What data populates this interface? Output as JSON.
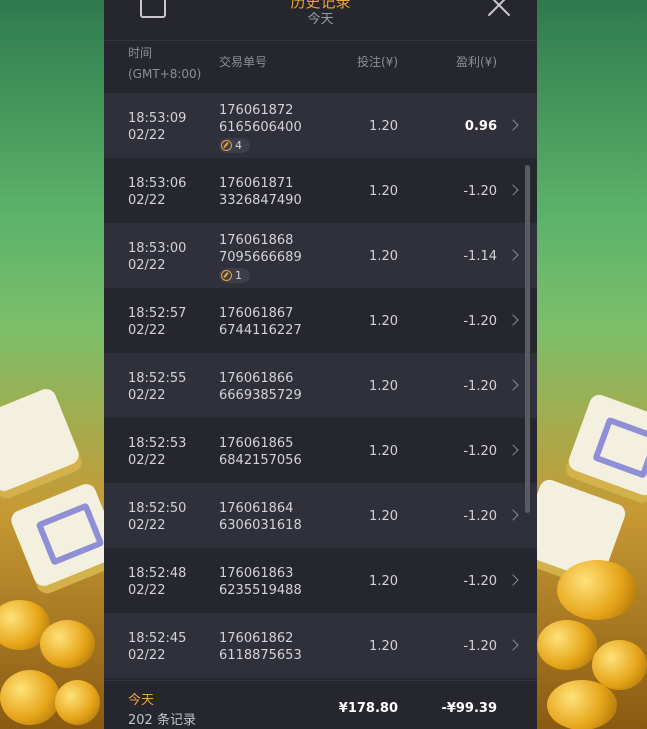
{
  "topbar": {
    "title": "历史记录",
    "subtitle": "今天"
  },
  "columns": {
    "time": "时间",
    "timezone": "(GMT+8:00)",
    "id": "交易单号",
    "bet": "投注(¥)",
    "profit": "盈利(¥)"
  },
  "rows": [
    {
      "time": "18:53:09",
      "date": "02/22",
      "id1": "176061872",
      "id2": "6165606400",
      "bet": "1.20",
      "profit": "0.96",
      "badge": "4"
    },
    {
      "time": "18:53:06",
      "date": "02/22",
      "id1": "176061871",
      "id2": "3326847490",
      "bet": "1.20",
      "profit": "-1.20"
    },
    {
      "time": "18:53:00",
      "date": "02/22",
      "id1": "176061868",
      "id2": "7095666689",
      "bet": "1.20",
      "profit": "-1.14",
      "badge": "1"
    },
    {
      "time": "18:52:57",
      "date": "02/22",
      "id1": "176061867",
      "id2": "6744116227",
      "bet": "1.20",
      "profit": "-1.20"
    },
    {
      "time": "18:52:55",
      "date": "02/22",
      "id1": "176061866",
      "id2": "6669385729",
      "bet": "1.20",
      "profit": "-1.20"
    },
    {
      "time": "18:52:53",
      "date": "02/22",
      "id1": "176061865",
      "id2": "6842157056",
      "bet": "1.20",
      "profit": "-1.20"
    },
    {
      "time": "18:52:50",
      "date": "02/22",
      "id1": "176061864",
      "id2": "6306031618",
      "bet": "1.20",
      "profit": "-1.20"
    },
    {
      "time": "18:52:48",
      "date": "02/22",
      "id1": "176061863",
      "id2": "6235519488",
      "bet": "1.20",
      "profit": "-1.20"
    },
    {
      "time": "18:52:45",
      "date": "02/22",
      "id1": "176061862",
      "id2": "6118875653",
      "bet": "1.20",
      "profit": "-1.20"
    }
  ],
  "footer": {
    "label": "今天",
    "count": "202 条记录",
    "bet_total": "¥178.80",
    "profit_total": "-¥99.39"
  },
  "icons": {
    "close": "close-icon",
    "calendar": "calendar-icon",
    "chevron": "chevron-right-icon",
    "free_spin": "free-spin-icon"
  },
  "colors": {
    "accent": "#f2a33c",
    "panel": "#26262f",
    "row_alt": "#30303a"
  }
}
